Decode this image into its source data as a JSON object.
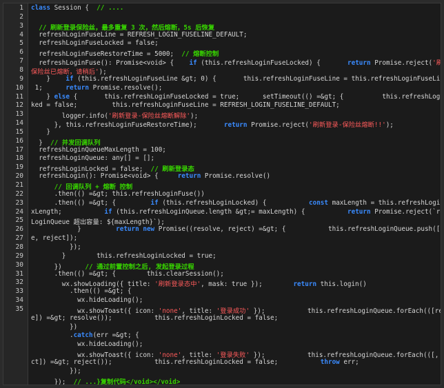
{
  "editor": {
    "line_numbers": [
      "1",
      "2",
      "3",
      "4",
      "5",
      "6",
      "7",
      "8",
      "9",
      "10",
      "11",
      "12",
      "13",
      "14",
      "15",
      "16",
      "17",
      "18",
      "19",
      "20",
      "21",
      "22",
      "23",
      "24",
      "25",
      "26",
      "27",
      "28",
      "29",
      "30",
      "31",
      "32",
      "33",
      "34",
      "35"
    ],
    "lines": [
      [
        {
          "t": "class ",
          "c": "kw"
        },
        {
          "t": "Session {  "
        },
        {
          "t": "// ....",
          "c": "cm"
        }
      ],
      [],
      [
        {
          "t": "  "
        },
        {
          "t": "// 刷新登录保险丝，最多重复 3 次，然后熔断，5s 后恢复",
          "c": "cm"
        }
      ],
      [
        {
          "t": "  refreshLoginFuseLine = REFRESH_LOGIN_FUSELINE_DEFAULT;"
        }
      ],
      [
        {
          "t": "  refreshLoginFuseLocked = false;"
        }
      ],
      [
        {
          "t": "  refreshLoginFuseRestoreTime = 5000;  "
        },
        {
          "t": "// 熔断控制",
          "c": "cm"
        }
      ],
      [
        {
          "t": "  refreshLoginFuse(): Promise<void> {    "
        },
        {
          "t": "if",
          "c": "kw"
        },
        {
          "t": " (this.refreshLoginFuseLocked) {       "
        },
        {
          "t": "return",
          "c": "kw"
        },
        {
          "t": " Promise.reject("
        },
        {
          "t": "'刷新登录-",
          "c": "st"
        }
      ],
      [
        {
          "t": "保险丝已熔断，请稍后'",
          "c": "st"
        },
        {
          "t": ");"
        }
      ],
      [
        {
          "t": "    }    "
        },
        {
          "t": "if",
          "c": "kw"
        },
        {
          "t": " (this.refreshLoginFuseLine &gt; 0) {       this.refreshLoginFuseLine = this.refreshLoginFuseLine -"
        }
      ],
      [
        {
          "t": " 1;      "
        },
        {
          "t": "return",
          "c": "kw"
        },
        {
          "t": " Promise.resolve();"
        }
      ],
      [
        {
          "t": "    } "
        },
        {
          "t": "else",
          "c": "kw"
        },
        {
          "t": " {       this.refreshLoginFuseLocked = true;      setTimeout(() =&gt; {          this.refreshLoginFuseLoc"
        }
      ],
      [
        {
          "t": "ked = false;         this.refreshLoginFuseLine = REFRESH_LOGIN_FUSELINE_DEFAULT;"
        }
      ],
      [
        {
          "t": "        logger.info("
        },
        {
          "t": "'刷新登录-保险丝熔断解除'",
          "c": "st"
        },
        {
          "t": ");"
        }
      ],
      [
        {
          "t": "      }, this.refreshLoginFuseRestoreTime);       "
        },
        {
          "t": "return",
          "c": "kw"
        },
        {
          "t": " Promise.reject("
        },
        {
          "t": "'刷新登录-保险丝熔断!!'",
          "c": "st"
        },
        {
          "t": ");"
        }
      ],
      [
        {
          "t": "    }"
        }
      ],
      [
        {
          "t": "  }  "
        },
        {
          "t": "// 并发回调队列",
          "c": "cm"
        }
      ],
      [
        {
          "t": "  refreshLoginQueueMaxLength = 100;"
        }
      ],
      [
        {
          "t": "  refreshLoginQueue: any[] = [];"
        }
      ],
      [
        {
          "t": "  refreshLoginLocked = false;  "
        },
        {
          "t": "// 刷新登录态",
          "c": "cm"
        }
      ],
      [
        {
          "t": "  refreshLogin(): Promise<void> {     "
        },
        {
          "t": "return",
          "c": "kw"
        },
        {
          "t": " Promise.resolve()"
        }
      ],
      [
        {
          "t": "      "
        },
        {
          "t": "// 回调队列 + 熔断 控制",
          "c": "cm"
        }
      ],
      [
        {
          "t": "      .then(() =&gt; this.refreshLoginFuse())"
        }
      ],
      [
        {
          "t": "      .then(() =&gt; {         "
        },
        {
          "t": "if",
          "c": "kw"
        },
        {
          "t": " (this.refreshLoginLocked) {           "
        },
        {
          "t": "const",
          "c": "kw"
        },
        {
          "t": " maxLength = this.refreshLoginQueueMa"
        }
      ],
      [
        {
          "t": "xLength;           "
        },
        {
          "t": "if",
          "c": "kw"
        },
        {
          "t": " (this.refreshLoginQueue.length &gt;= maxLength) {           "
        },
        {
          "t": "return",
          "c": "kw"
        },
        {
          "t": " Promise.reject(`refresh"
        }
      ],
      [
        {
          "t": "LoginQueue 超出容量: ${maxLength}`);"
        }
      ],
      [
        {
          "t": "            }         "
        },
        {
          "t": "return",
          "c": "kw"
        },
        {
          "t": " "
        },
        {
          "t": "new",
          "c": "kw"
        },
        {
          "t": " Promise((resolve, reject) =&gt; {           this.refreshLoginQueue.push([resolv"
        }
      ],
      [
        {
          "t": "e, reject]);"
        }
      ],
      [
        {
          "t": "          });"
        }
      ],
      [
        {
          "t": "        }        this.refreshLoginLocked = true;"
        }
      ],
      [
        {
          "t": "      })      "
        },
        {
          "t": "// 通过前置控制之后, 发起登录过程",
          "c": "cm"
        }
      ],
      [
        {
          "t": "      .then(() =&gt; {        this.clearSession();"
        }
      ],
      [
        {
          "t": "        wx.showLoading({ title: "
        },
        {
          "t": "'刷新登录态中'",
          "c": "st"
        },
        {
          "t": ", mask: true });        "
        },
        {
          "t": "return",
          "c": "kw"
        },
        {
          "t": " this.login()"
        }
      ],
      [
        {
          "t": "          .then(() =&gt; {"
        }
      ],
      [
        {
          "t": "            wx.hideLoading();"
        }
      ],
      [
        {
          "t": "            wx.showToast({ icon: "
        },
        {
          "t": "'none'",
          "c": "st"
        },
        {
          "t": ", title: "
        },
        {
          "t": "'登录成功'",
          "c": "st"
        },
        {
          "t": " });           this.refreshLoginQueue.forEach(([resolv"
        }
      ],
      [
        {
          "t": "e]) =&gt; resolve());           this.refreshLoginLocked = false;"
        }
      ],
      [
        {
          "t": "          })"
        }
      ],
      [
        {
          "t": "          ."
        },
        {
          "t": "catch",
          "c": "kw"
        },
        {
          "t": "(err =&gt; {"
        }
      ],
      [
        {
          "t": "            wx.hideLoading();"
        }
      ],
      [
        {
          "t": "            wx.showToast({ icon: "
        },
        {
          "t": "'none'",
          "c": "st"
        },
        {
          "t": ", title: "
        },
        {
          "t": "'登录失败'",
          "c": "st"
        },
        {
          "t": " });           this.refreshLoginQueue.forEach(([, reje"
        }
      ],
      [
        {
          "t": "ct]) =&gt; reject());           this.refreshLoginLocked = false;           "
        },
        {
          "t": "throw",
          "c": "kw"
        },
        {
          "t": " err;"
        }
      ],
      [
        {
          "t": "          });"
        }
      ],
      [
        {
          "t": "      });  "
        },
        {
          "t": "// ...}复制代码</void></void>",
          "c": "cm"
        }
      ]
    ]
  }
}
